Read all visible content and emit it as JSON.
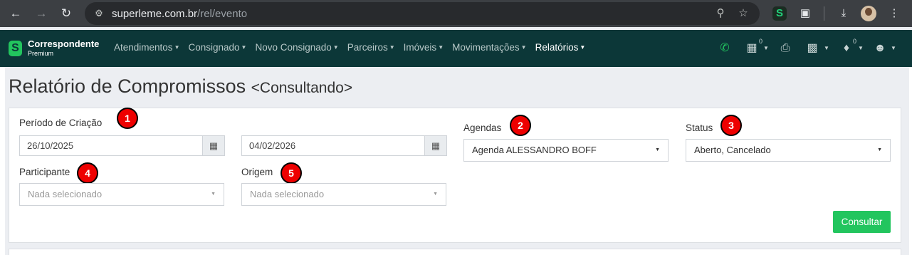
{
  "browser": {
    "url_host": "superleme.com.br",
    "url_path": "/rel/evento",
    "icons": [
      "back-icon",
      "forward-icon",
      "reload-icon",
      "site-settings-icon",
      "zoom-icon",
      "star-icon",
      "extension-s-icon",
      "extensions-puzzle-icon",
      "download-icon",
      "profile-avatar-icon",
      "kebab-menu-icon"
    ]
  },
  "navbar": {
    "brand_name": "Correspondente",
    "brand_sub": "Premium",
    "brand_color": "#0c3738",
    "accent_color": "#22c55e",
    "menu": [
      {
        "label": "Atendimentos"
      },
      {
        "label": "Consignado"
      },
      {
        "label": "Novo Consignado"
      },
      {
        "label": "Parceiros"
      },
      {
        "label": "Imóveis"
      },
      {
        "label": "Movimentações"
      },
      {
        "label": "Relatórios"
      }
    ],
    "calendar_badge": "0",
    "bell_badge": "0"
  },
  "page": {
    "title": "Relatório de Compromissos",
    "subtitle": "<Consultando>"
  },
  "form": {
    "periodo_label": "Período de Criação",
    "date_start": "26/10/2025",
    "date_end": "04/02/2026",
    "agendas_label": "Agendas",
    "agendas_value": "Agenda ALESSANDRO BOFF",
    "status_label": "Status",
    "status_value": "Aberto, Cancelado",
    "participante_label": "Participante",
    "participante_placeholder": "Nada selecionado",
    "origem_label": "Origem",
    "origem_placeholder": "Nada selecionado",
    "submit_label": "Consultar"
  },
  "annotations": [
    "1",
    "2",
    "3",
    "4",
    "5"
  ]
}
